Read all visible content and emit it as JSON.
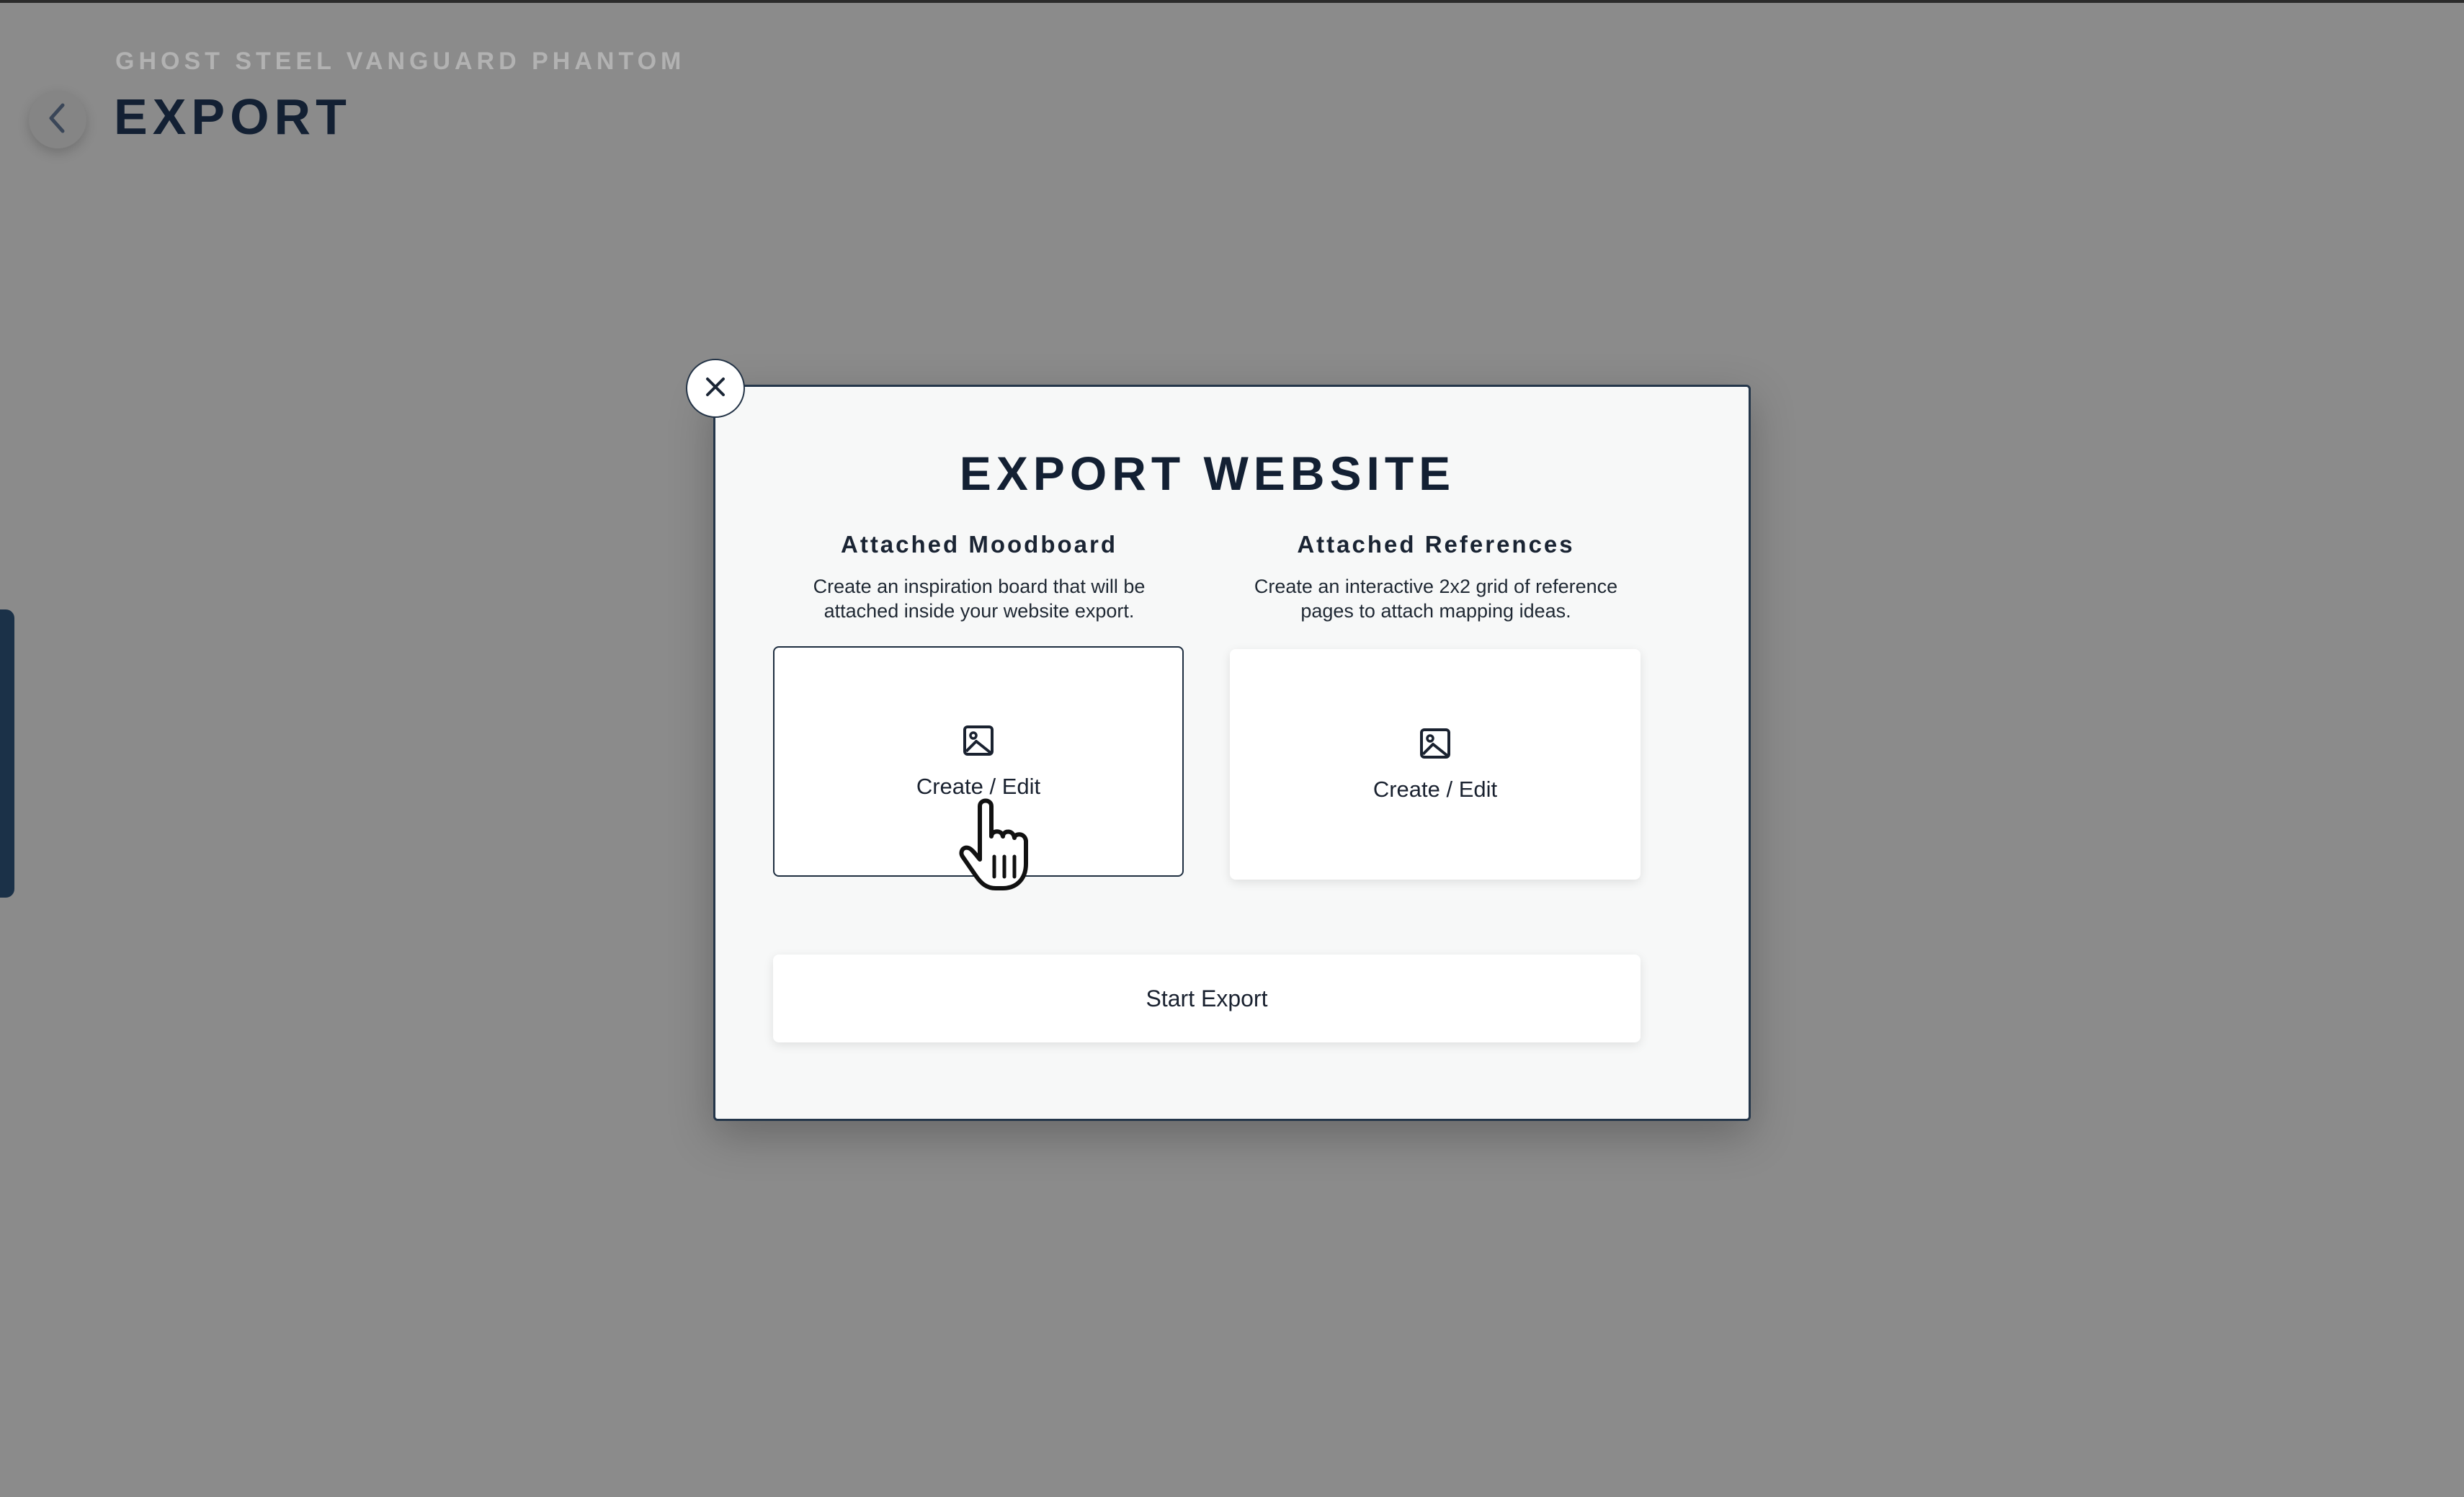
{
  "header": {
    "project_name": "GHOST STEEL VANGUARD PHANTOM",
    "title": "EXPORT",
    "back_icon": "chevron-left-icon"
  },
  "modal": {
    "title": "EXPORT WEBSITE",
    "close_icon": "close-icon",
    "moodboard": {
      "heading": "Attached Moodboard",
      "description": "Create an inspiration board that will be attached inside your website export.",
      "button_label": "Create / Edit",
      "icon": "image-icon"
    },
    "references": {
      "heading": "Attached References",
      "description": "Create an interactive 2x2 grid of reference pages to attach mapping ideas.",
      "button_label": "Create / Edit",
      "icon": "image-icon"
    },
    "start_export_label": "Start Export"
  },
  "colors": {
    "overlay_background": "#8b8b8b",
    "modal_background": "#f7f8f8",
    "accent_navy": "#1b3148",
    "text_dark": "#132033"
  }
}
